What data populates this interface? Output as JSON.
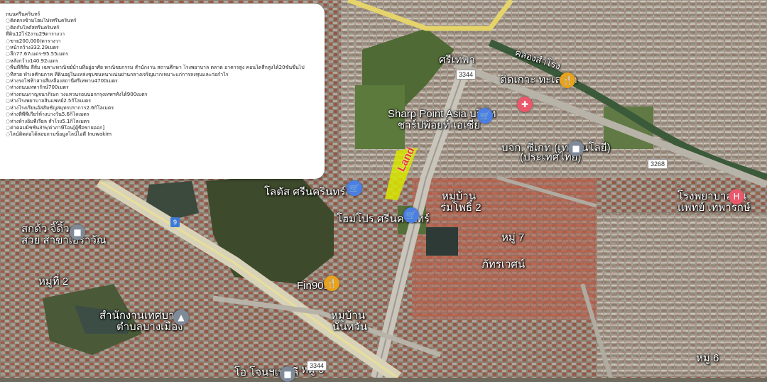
{
  "panel": {
    "lines": [
      "ถนนศรีนครินทร์",
      "◌ติดตรงข้ามโฮมโปรศรีนครินทร์",
      "◌ติดกับโลตัสศรีนครินทร์",
      "ที่ดิน12ไร่2งาน29ตารางวา",
      "◌ขาย200,000/ตารางวา",
      "◌หน้ากว้าง332.29เมตร",
      "◌ลึก77.67เมตร-95.55เมตร",
      "◌หลังกว้าง140.92เมตร",
      "◌พื้นที่สีส้ม สีส้ม เฉพาะพาณิชย์บ้านที่อยู่อาศัย พาณิชยกรรม สำนักงาน สถานศึกษา โรงพยาบาล ตลาด อาคารสูง คอนโดสีกสูงได้20ชั้นขึ้นไป",
      "◌ที่สวย ทำเลศักยภาพ ที่ดินอยู่ในแหล่งชุมชนหนาแน่นย่านกลางเจริญมากเหมาะแก่การลงทุนและก่อกำไร",
      "◌ห่างรถไฟฟ้าสายสีเหลืองสถานีศรีเทพาน4700เมตร",
      "◌ห่างถนนเทพารักษ์700เมตร",
      "◌ห่างถนนกาญจนาภิเษก วงแหวนรอบนอกกรุงเทพฯทั้งได้900เมตร",
      "◌ห่างโรงพยาบาลสินแพทย์2.5กิโลเมตร",
      "◌ห่างโรงเรียนอัสสัมชัญสมุทรปราการ2.6กิโลเมตร",
      "◌ห่างทีพีพีเกียร์ห้างบางวัน5.6กิโลเมตร",
      "◌ห่างห้างอิมพีเรียล สำโรง5.1กิโลเมตร",
      "◌ค่าคอมมิชชั่น3%/ค่าภาษีโอน[ผู้ซื้อขายออก]",
      "◌ไลน์ติดต่อได้สอบถามข้อมูลไลน์ไอดี Inuwakim"
    ]
  },
  "map": {
    "land_label": "Land",
    "labels": {
      "srithepa": "ศรีเทพา",
      "sharp_point_en": "Sharp Point Asia บริษัท",
      "sharp_point_th": "ชาร์ปพ้อยท์ เอเชีย",
      "sea_crab": "ติดเกาะ ทะเลเผา",
      "bjc_1": "บจก. ซีเกท (เทคโนโลยี)",
      "bjc_2": "(ประเทศไทย)",
      "lotus": "โลตัส ศรีนครินทร์",
      "village_1": "หมู่บ้าน",
      "village_1b": "ร่มโพธิ์ 2",
      "homepro": "โฮมโปร ศรีนครินทร์",
      "moo7": "หมู่ 7",
      "hospital_1": "โรงพยาบาลสิน",
      "hospital_2": "แพทย์ เทพารักษ์",
      "sakdo_1": "สกด้ว จิ๊ดิ้ว",
      "sakdo_2": "สวย สาขาเอราวัณ",
      "moo2": "หมู่ที่ 2",
      "fin90s": "Fin90s",
      "phattharawet": "ภัทรเวศน์",
      "office_1": "สำนักงานเทศบาล",
      "office_2": "ตำบลบางเมือง",
      "village_2": "หมู่บ้าน",
      "village_2b": "นันทวัน",
      "moo6": "หมู่ 6",
      "moo5": "หมู่ 5",
      "bottom_place": "โอ โจนฯเทลลี",
      "canal": "คลองสำโรง"
    },
    "route_badges": {
      "r3344a": "3344",
      "r3268": "3268",
      "r3344b": "3344",
      "r9": "9"
    },
    "icons": {
      "shop": "cart-icon",
      "food": "fork-knife-icon",
      "hospital": "hospital-icon",
      "building": "building-icon",
      "office": "government-icon"
    }
  }
}
